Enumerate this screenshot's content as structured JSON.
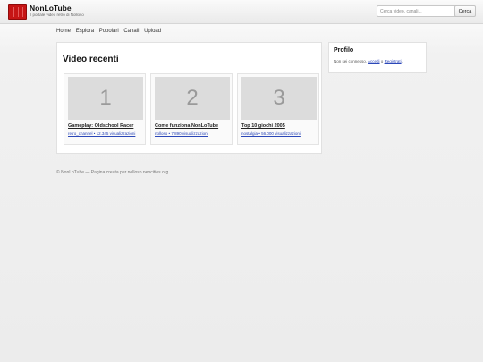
{
  "header": {
    "title": "NonLoTube",
    "subtitle": "Il portale video retrò di Nolloso",
    "search_placeholder": "Cerca video, canali...",
    "search_button": "Cerca"
  },
  "nav": {
    "items": [
      "Home",
      "Esplora",
      "Popolari",
      "Canali",
      "Upload"
    ]
  },
  "main": {
    "section_title": "Video recenti",
    "videos": [
      {
        "thumb": "1",
        "title": "Gameplay: Oldschool Racer",
        "meta": "retro_channel • 12.345 visualizzazioni"
      },
      {
        "thumb": "2",
        "title": "Come funziona NonLoTube",
        "meta": "nolloso • 7.890 visualizzazioni"
      },
      {
        "thumb": "3",
        "title": "Top 10 giochi 2005",
        "meta": "nostalgia • 56.000 visualizzazioni"
      }
    ]
  },
  "sidebar": {
    "title": "Profilo",
    "text_before": "Non sei connesso. ",
    "login_link": "Accedi",
    "text_middle": " o ",
    "register_link": "Registrati",
    "text_after": "."
  },
  "footer": {
    "text": "© NonLoTube — Pagina creata per nolloso.neocities.org"
  },
  "colors": {
    "brand": "#c61515",
    "link": "#2b47b8"
  }
}
